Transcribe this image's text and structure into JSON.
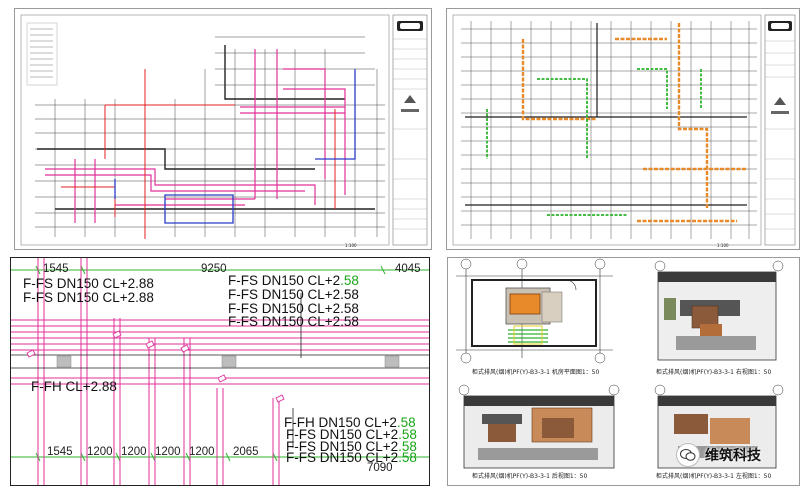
{
  "panel_tl": {
    "scale_note": "1:100"
  },
  "panel_tr": {
    "scale_note": "1:100"
  },
  "panel_bl": {
    "dims_top": [
      "1545",
      "9250",
      "4045"
    ],
    "dims_bottom": [
      "1545",
      "1200",
      "1200",
      "1200",
      "1200",
      "2065",
      "7090"
    ],
    "labels_left": [
      "F-FS DN150 CL+2.88",
      "F-FS DN150 CL+2.88",
      "F-FH CL+2.88"
    ],
    "labels_top_right": [
      {
        "main": "F-FS DN150 CL+2",
        "suffix": ".58"
      },
      {
        "main": "F-FS DN150 CL+2.58",
        "suffix": ""
      },
      {
        "main": "F-FS DN150 CL+2.58",
        "suffix": ""
      },
      {
        "main": "F-FS DN150 CL+2.58",
        "suffix": ""
      }
    ],
    "labels_bottom_right": [
      {
        "main": "F-FH DN150 CL+2",
        "suffix": ".58"
      },
      {
        "main": "F-FS DN150 CL+2",
        "suffix": ".58"
      },
      {
        "main": "F-FS DN150 CL+2",
        "suffix": ".58"
      },
      {
        "main": "F-FS DN150 CL+2",
        "suffix": ".58"
      }
    ]
  },
  "panel_br": {
    "captions": [
      "柜式排风(烟)机PF(Y)-B3-3-1 机房平面图1：50",
      "柜式排风(烟)机PF(Y)-B3-3-1 右视图1：50",
      "柜式排风(烟)机PF(Y)-B3-3-1 后视图1：50",
      "柜式排风(烟)机PF(Y)-B3-3-1 左视图1：50"
    ],
    "axis_tags": [
      "D-6",
      "D-7",
      "D-8",
      "D-1",
      "D-7",
      "D-8",
      "D-7",
      "D-8"
    ]
  },
  "watermark": {
    "text": "维筑科技",
    "icon": "wechat-bubble-icon"
  },
  "colors": {
    "pipe_magenta": "#e0309a",
    "pipe_red": "#e02020",
    "pipe_blue": "#2a3cc8",
    "grid_green": "#2db52d",
    "duct_orange": "#e88a2a",
    "equip_brown": "#8a5a3a"
  }
}
